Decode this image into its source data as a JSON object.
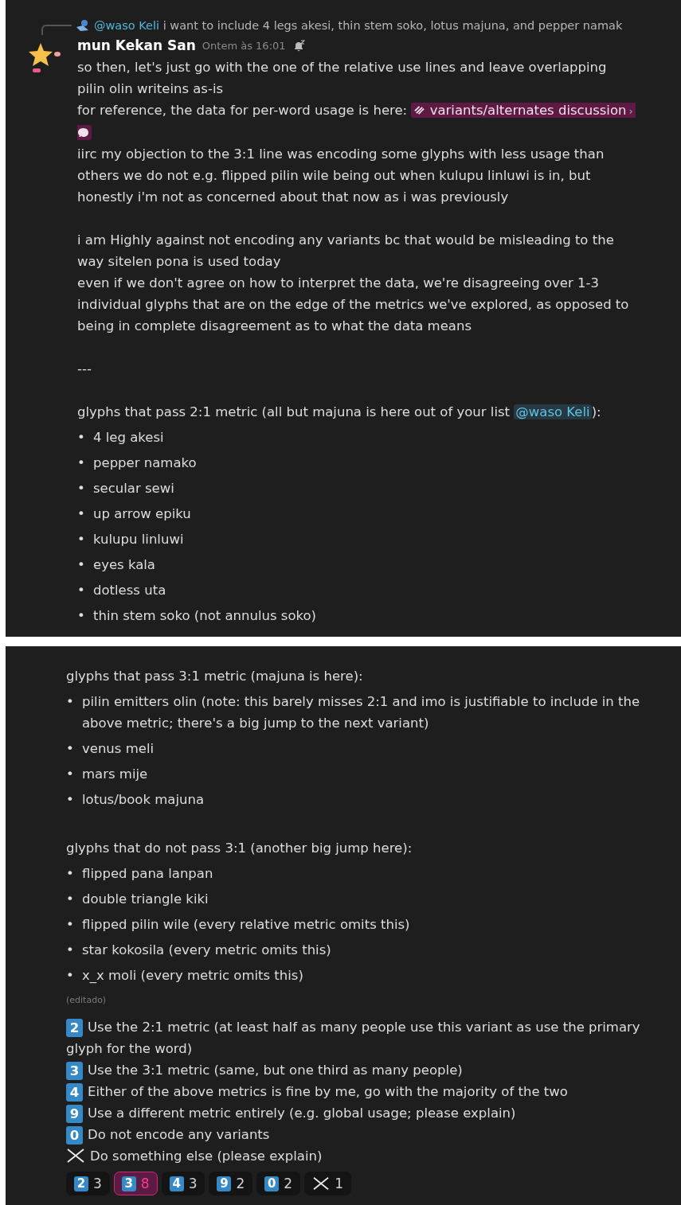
{
  "message": {
    "reply": {
      "mention": "@waso Keli",
      "text": "i want to include 4 legs akesi, thin stem soko, lotus majuna, and pepper namak"
    },
    "author": "mun Kekan San",
    "timestamp": "Ontem às 16:01",
    "blocks": [
      {
        "kind": "lines",
        "lines": [
          [
            {
              "kind": "text",
              "text": "so then, let's just go with the one of the relative use lines and leave overlapping pilin olin writeins as-is"
            }
          ],
          [
            {
              "kind": "text",
              "text": "for reference, the data for per-word usage is here: "
            },
            {
              "kind": "link",
              "text": "variants/alternates discussion",
              "arrow": "›"
            }
          ],
          [
            {
              "kind": "text",
              "text": "iirc my objection to the 3:1 line was encoding some glyphs with less usage than others we do not e.g. flipped pilin wile being out when kulupu linluwi is in, but honestly i'm not as concerned about that now as i was previously"
            }
          ]
        ]
      },
      {
        "kind": "lines",
        "lines": [
          [
            {
              "kind": "text",
              "text": "i am Highly against not encoding any variants bc that would be misleading to the way sitelen pona is used today"
            }
          ],
          [
            {
              "kind": "text",
              "text": "even if we don't agree on how to interpret the data, we're disagreeing over 1-3 individual glyphs that are on the edge of the metrics we've explored, as opposed to being in complete disagreement as to what the data means"
            }
          ]
        ]
      },
      {
        "kind": "lines",
        "lines": [
          [
            {
              "kind": "text",
              "text": "---"
            }
          ]
        ]
      },
      {
        "kind": "lines",
        "lines": [
          [
            {
              "kind": "text",
              "text": "glyphs that pass 2:1 metric (all but majuna is here out of your list "
            },
            {
              "kind": "mention",
              "text": "@waso Keli"
            },
            {
              "kind": "text",
              "text": "):"
            }
          ]
        ]
      },
      {
        "kind": "list",
        "marker": "•",
        "items": [
          "4 leg akesi",
          "pepper namako",
          "secular sewi",
          "up arrow epiku",
          "kulupu linluwi",
          "eyes kala",
          "dotless uta",
          "thin stem soko (not annulus soko)"
        ]
      }
    ]
  },
  "continuation": {
    "blocks": [
      {
        "kind": "lines",
        "lines": [
          [
            {
              "kind": "text",
              "text": "glyphs that pass 3:1 metric (majuna is here):"
            }
          ]
        ]
      },
      {
        "kind": "list",
        "marker": "•",
        "items": [
          "pilin emitters olin (note: this barely misses 2:1 and imo is justifiable to include in the above metric; there's a big jump to the next variant)",
          "venus meli",
          "mars mije",
          "lotus/book majuna"
        ]
      },
      {
        "kind": "lines",
        "lines": [
          [
            {
              "kind": "text",
              "text": "glyphs that do not pass 3:1 (another big jump here):"
            }
          ]
        ]
      },
      {
        "kind": "list",
        "marker": "•",
        "items": [
          "flipped pana lanpan",
          "double triangle kiki",
          "flipped pilin wile (every relative metric omits this)",
          "star kokosila (every metric omits this)",
          "x_x moli (every metric omits this)"
        ]
      }
    ],
    "edited": "(editado)",
    "poll": [
      {
        "kind": "keycap",
        "key": "2",
        "text": "Use the 2:1 metric (at least half as many people use this variant as use the primary glyph for the word)"
      },
      {
        "kind": "keycap",
        "key": "3",
        "text": "Use the 3:1 metric (same, but one third as many people)"
      },
      {
        "kind": "keycap",
        "key": "4",
        "text": "Either of the above metrics is fine by me, go with the majority of the two"
      },
      {
        "kind": "keycap",
        "key": "9",
        "text": "Use a different metric entirely (e.g. global usage; please explain)"
      },
      {
        "kind": "keycap",
        "key": "0",
        "text": "Do not encode any variants"
      },
      {
        "kind": "cross",
        "text": "Do something else (please explain)"
      }
    ],
    "reactions": [
      {
        "kind": "keycap",
        "key": "2",
        "count": "3",
        "selected": false
      },
      {
        "kind": "keycap",
        "key": "3",
        "count": "8",
        "selected": true
      },
      {
        "kind": "keycap",
        "key": "4",
        "count": "3",
        "selected": false
      },
      {
        "kind": "keycap",
        "key": "9",
        "count": "2",
        "selected": false
      },
      {
        "kind": "keycap",
        "key": "0",
        "count": "2",
        "selected": false
      },
      {
        "kind": "cross",
        "count": "1",
        "selected": false
      }
    ]
  }
}
